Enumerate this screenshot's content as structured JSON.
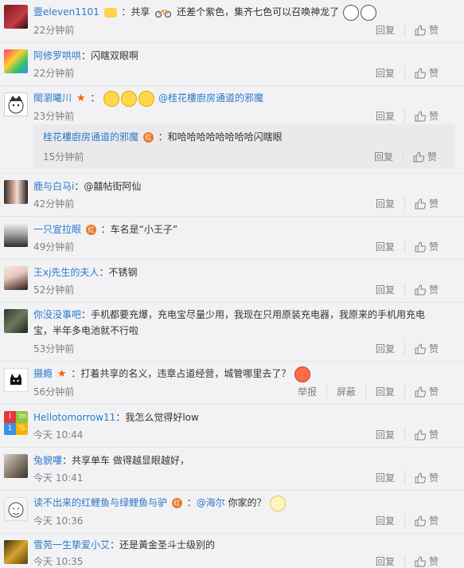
{
  "actions": {
    "reply": "回复",
    "like": "赞",
    "report": "举报",
    "block": "屏蔽"
  },
  "comments": [
    {
      "user": "壹eleven1101",
      "text": "：共享",
      "text2": "还差个紫色，集齐七色可以召唤神龙了",
      "time": "22分钟前"
    },
    {
      "user": "阿修罗哄哄",
      "text": "：闪瞎双眼啊",
      "time": "22分钟前"
    },
    {
      "user": "閩瀏曦川",
      "mention": "@桂花樓廚房通道的邪魔",
      "time": "23分钟前",
      "reply": {
        "user": "桂花樓廚房通道的邪魔",
        "badge": "红",
        "text": "：和哈哈哈哈哈哈哈哈闪瞎眼",
        "time": "15分钟前"
      }
    },
    {
      "user": "鹿与白马i",
      "text": "：@囍帖街阿仙",
      "time": "42分钟前"
    },
    {
      "user": "一只宣拉眼",
      "badge": "红",
      "text": "：车名是“小王子”",
      "time": "49分钟前"
    },
    {
      "user": "王xj先生的夫人",
      "text": "：不锈钢",
      "time": "52分钟前"
    },
    {
      "user": "你没没事吧",
      "text": "：手机都要充爆，充电宝尽量少用，我现在只用原装充电器，我原来的手机用充电宝，半年多电池就不行啦",
      "time": "53分钟前"
    },
    {
      "user": "摄瘾",
      "text": "：打着共享的名义，违章占道经营，城管哪里去了？",
      "time": "56分钟前"
    },
    {
      "user": "Hellotomorrow11",
      "text": "：我怎么觉得好low",
      "time": "今天 10:44"
    },
    {
      "user": "兔貌嘍",
      "text": "：共享单车 做得越显眼越好，",
      "time": "今天 10:41"
    },
    {
      "user": "读不出来的红鲤鱼与绿鲤鱼与驴",
      "badge": "红",
      "text": "：",
      "mention": "@海尔",
      "text2": " 你家的？",
      "time": "今天 10:36"
    },
    {
      "user": "雪苑一生挚爱小艾",
      "text": "：还是黃金圣斗士级别的",
      "time": "今天 10:35"
    }
  ],
  "avatar_logo": {
    "l1": "I",
    "l2": "'m",
    "l3": "1",
    "l4": "%"
  },
  "colors": {
    "username": "#eb7350",
    "link": "#2a7bc8",
    "meta": "#808080",
    "background": "#f2f2f5"
  }
}
